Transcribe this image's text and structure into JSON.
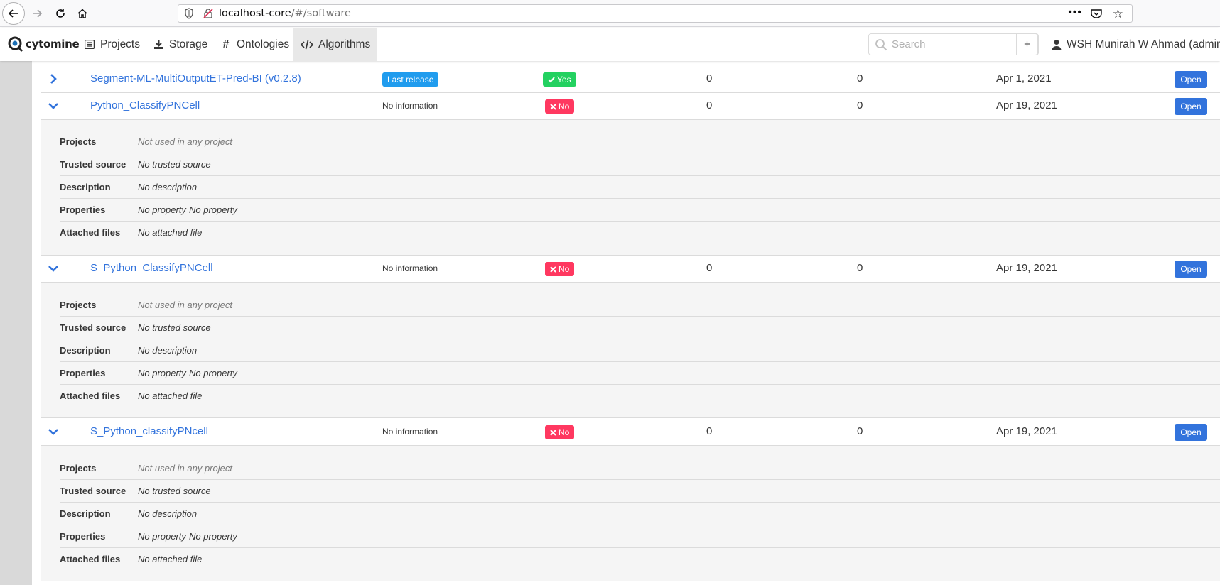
{
  "browser": {
    "url_host": "localhost-core",
    "url_path": "/#/software"
  },
  "navbar": {
    "logo_text": "cytomine",
    "items": [
      {
        "label": "Projects",
        "icon": "list-icon"
      },
      {
        "label": "Storage",
        "icon": "download-icon"
      },
      {
        "label": "Ontologies",
        "icon": "hashtag-icon"
      },
      {
        "label": "Algorithms",
        "icon": "code-icon",
        "active": true
      }
    ],
    "search_placeholder": "Search",
    "add_label": "+",
    "user_label": "WSH Munirah W Ahmad (admin)"
  },
  "algorithms": [
    {
      "name": "Segment-ML-MultiOutputET-Pred-BI (v0.2.8)",
      "release_status": "Last release",
      "trusted_label": "Yes",
      "trusted": true,
      "count_a": "0",
      "count_b": "0",
      "date": "Apr 1, 2021",
      "open_label": "Open",
      "expanded": false
    },
    {
      "name": "Python_ClassifyPNCell",
      "release_status": "No information",
      "trusted_label": "No",
      "trusted": false,
      "count_a": "0",
      "count_b": "0",
      "date": "Apr 19, 2021",
      "open_label": "Open",
      "expanded": true,
      "details": {
        "projects_label": "Projects",
        "projects": "Not used in any project",
        "trusted_label": "Trusted source",
        "trusted": "No trusted source",
        "description_label": "Description",
        "description": "No description",
        "properties_label": "Properties",
        "property_1": "No property",
        "property_2": "No property",
        "files_label": "Attached files",
        "files": "No attached file"
      }
    },
    {
      "name": "S_Python_ClassifyPNCell",
      "release_status": "No information",
      "trusted_label": "No",
      "trusted": false,
      "count_a": "0",
      "count_b": "0",
      "date": "Apr 19, 2021",
      "open_label": "Open",
      "expanded": true,
      "details": {
        "projects_label": "Projects",
        "projects": "Not used in any project",
        "trusted_label": "Trusted source",
        "trusted": "No trusted source",
        "description_label": "Description",
        "description": "No description",
        "properties_label": "Properties",
        "property_1": "No property",
        "property_2": "No property",
        "files_label": "Attached files",
        "files": "No attached file"
      }
    },
    {
      "name": "S_Python_classifyPNcell",
      "release_status": "No information",
      "trusted_label": "No",
      "trusted": false,
      "count_a": "0",
      "count_b": "0",
      "date": "Apr 19, 2021",
      "open_label": "Open",
      "expanded": true,
      "details": {
        "projects_label": "Projects",
        "projects": "Not used in any project",
        "trusted_label": "Trusted source",
        "trusted": "No trusted source",
        "description_label": "Description",
        "description": "No description",
        "properties_label": "Properties",
        "property_1": "No property",
        "property_2": "No property",
        "files_label": "Attached files",
        "files": "No attached file"
      }
    }
  ],
  "colors": {
    "link": "#3273dc",
    "release_tag": "#209cee",
    "yes_tag": "#23d160",
    "no_tag": "#ff3860",
    "open_button": "#3273dc"
  }
}
